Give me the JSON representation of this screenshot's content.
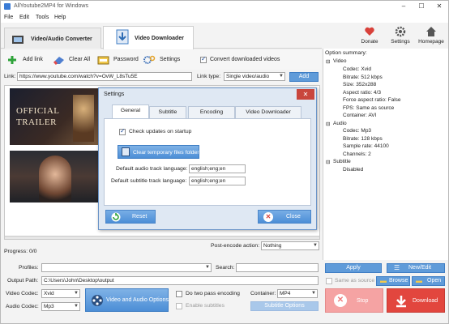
{
  "window": {
    "title": "AllYoutube2MP4 for Windows",
    "controls": [
      "–",
      "☐",
      "✕"
    ]
  },
  "menu": [
    "File",
    "Edit",
    "Tools",
    "Help"
  ],
  "tabs": [
    {
      "label": "Video/Audio Converter",
      "active": false
    },
    {
      "label": "Video Downloader",
      "active": true
    }
  ],
  "top_right": {
    "donate": "Donate",
    "settings": "Settings",
    "homepage": "Homepage"
  },
  "toolbar": {
    "add_link": "Add link",
    "clear_all": "Clear All",
    "password": "Password",
    "settings": "Settings",
    "convert_label": "Convert downloaded videos",
    "convert_checked": true
  },
  "link_row": {
    "label": "Link:",
    "url": "https://www.youtube.com/watch?v=OvW_L8sTu5E",
    "type_label": "Link type:",
    "type_value": "Single video/audio",
    "add_button": "Add"
  },
  "option_summary": {
    "title": "Option summary:",
    "tree": [
      {
        "text": "Video",
        "level": 0
      },
      {
        "text": "Codec: Xvid",
        "level": 1
      },
      {
        "text": "Bitrate: 512 kbps",
        "level": 1
      },
      {
        "text": "Size: 352x288",
        "level": 1
      },
      {
        "text": "Aspect ratio: 4/3",
        "level": 1
      },
      {
        "text": "Force aspect ratio: False",
        "level": 1
      },
      {
        "text": "FPS: Same as source",
        "level": 1
      },
      {
        "text": "Container: AVI",
        "level": 1
      },
      {
        "text": "Audio",
        "level": 0
      },
      {
        "text": "Codec: Mp3",
        "level": 1
      },
      {
        "text": "Bitrate: 128 kbps",
        "level": 1
      },
      {
        "text": "Sample rate: 44100",
        "level": 1
      },
      {
        "text": "Channels: 2",
        "level": 1
      },
      {
        "text": "Subtitle",
        "level": 0
      },
      {
        "text": "Disabled",
        "level": 1
      }
    ]
  },
  "thumbnails": [
    {
      "caption": "OFFICIAL",
      "caption2": "TRAILER"
    },
    {
      "caption": "",
      "caption2": ""
    }
  ],
  "progress": {
    "label": "Progress: 0/0",
    "post_encode_label": "Post-encode action:",
    "post_encode_value": "Nothing",
    "value": 0
  },
  "bottom": {
    "profiles_label": "Profiles:",
    "profiles_value": "",
    "search_label": "Search:",
    "search_value": "",
    "output_label": "Output Path:",
    "output_value": "C:\\Users\\John\\Desktop\\output",
    "video_codec_label": "Video Codec:",
    "video_codec_value": "Xvid",
    "audio_codec_label": "Audio Codec:",
    "audio_codec_value": "Mp3",
    "video_audio_options": "Video and Audio Options",
    "two_pass_label": "Do two pass encoding",
    "enable_subtitles_label": "Enable subtitles",
    "container_label": "Container:",
    "container_value": "MP4",
    "subtitle_options": "Subtitle Options",
    "apply": "Apply",
    "new_edit": "New/Edit",
    "same_as_source": "Same as source",
    "browse": "Browse",
    "open": "Open",
    "stop": "Stop",
    "download": "Download"
  },
  "dialog": {
    "title": "Settings",
    "tabs": [
      "General",
      "Subtitle",
      "Encoding",
      "Video Downloader"
    ],
    "active_tab": "General",
    "check_updates_label": "Check updates on startup",
    "check_updates_checked": true,
    "clear_temp_button": "Clear temporary files folder",
    "audio_lang_label": "Default audio track language:",
    "audio_lang_value": "english;eng;en",
    "subtitle_lang_label": "Default subtitle track language:",
    "subtitle_lang_value": "english;eng;en",
    "reset_button": "Reset",
    "close_button": "Close"
  },
  "colors": {
    "accent_blue": "#5f9bd9",
    "stop_red": "#f07b7b",
    "download_red": "#e2463e",
    "dialog_close_red": "#c9463d"
  }
}
